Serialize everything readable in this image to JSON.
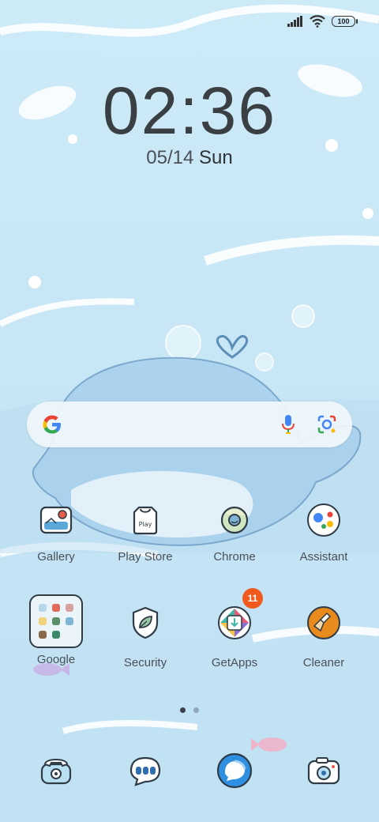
{
  "status_bar": {
    "battery": "100",
    "signal_icon": "signal-icon",
    "wifi_icon": "wifi-icon"
  },
  "clock": {
    "time": "02:36",
    "date": "05/14",
    "day": "Sun"
  },
  "search": {
    "g_icon": "google-g-icon",
    "mic_icon": "mic-icon",
    "lens_icon": "lens-icon"
  },
  "apps_row1": [
    {
      "label": "Gallery",
      "icon": "gallery-icon"
    },
    {
      "label": "Play Store",
      "icon": "play-store-icon",
      "icon_text": "Play"
    },
    {
      "label": "Chrome",
      "icon": "chrome-icon"
    },
    {
      "label": "Assistant",
      "icon": "assistant-icon"
    }
  ],
  "apps_row2": [
    {
      "label": "Google",
      "icon": "folder-icon"
    },
    {
      "label": "Security",
      "icon": "security-icon"
    },
    {
      "label": "GetApps",
      "icon": "getapps-icon",
      "badge": "11"
    },
    {
      "label": "Cleaner",
      "icon": "cleaner-icon"
    }
  ],
  "dock": [
    {
      "icon": "phone-icon"
    },
    {
      "icon": "messages-icon"
    },
    {
      "icon": "browser-icon"
    },
    {
      "icon": "camera-icon"
    }
  ],
  "page_indicator": {
    "pages": 2,
    "current": 1
  },
  "colors": {
    "badge": "#f05a1c",
    "cleaner": "#e88a1c",
    "background": "#c7e6f6"
  }
}
